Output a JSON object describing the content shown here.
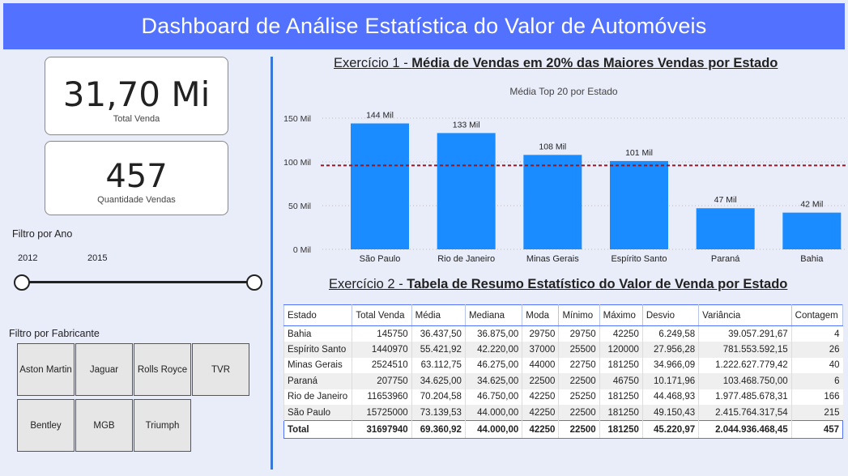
{
  "header": {
    "title": "Dashboard de Análise Estatística do Valor de Automóveis"
  },
  "kpis": {
    "total_venda": {
      "value": "31,70 Mi",
      "label": "Total Venda"
    },
    "quantidade": {
      "value": "457",
      "label": "Quantidade Vendas"
    }
  },
  "filtro_ano": {
    "label": "Filtro por Ano",
    "start": "2012",
    "end": "2015"
  },
  "filtro_fabricante": {
    "label": "Filtro por Fabricante",
    "items": [
      "Aston Martin",
      "Jaguar",
      "Rolls Royce",
      "TVR",
      "Bentley",
      "MGB",
      "Triumph"
    ]
  },
  "exercicio1": {
    "prefix": "Exercício 1 - ",
    "title": "Média de Vendas em 20% das Maiores Vendas por Estado"
  },
  "exercicio2": {
    "prefix": "Exercício 2 - ",
    "title": "Tabela de Resumo Estatístico do Valor de Venda por Estado"
  },
  "chart_data": {
    "type": "bar",
    "title": "Média Top 20 por Estado",
    "categories": [
      "São Paulo",
      "Rio de Janeiro",
      "Minas Gerais",
      "Espírito Santo",
      "Paraná",
      "Bahia"
    ],
    "values": [
      144000,
      133000,
      108000,
      101000,
      47000,
      42000
    ],
    "data_labels": [
      "144 Mil",
      "133 Mil",
      "108 Mil",
      "101 Mil",
      "47 Mil",
      "42 Mil"
    ],
    "ylim": [
      0,
      150000
    ],
    "yticks": [
      0,
      50000,
      100000,
      150000
    ],
    "ytick_labels": [
      "0 Mil",
      "50 Mil",
      "100 Mil",
      "150 Mil"
    ],
    "reference_line": 96000,
    "bar_color": "#1a8cff",
    "reference_color": "#8b1a2b",
    "grid": true
  },
  "table": {
    "columns": [
      "Estado",
      "Total Venda",
      "Média",
      "Mediana",
      "Moda",
      "Mínimo",
      "Máximo",
      "Desvio",
      "Variância",
      "Contagem"
    ],
    "rows": [
      [
        "Bahia",
        "145750",
        "36.437,50",
        "36.875,00",
        "29750",
        "29750",
        "42250",
        "6.249,58",
        "39.057.291,67",
        "4"
      ],
      [
        "Espírito Santo",
        "1440970",
        "55.421,92",
        "42.220,00",
        "37000",
        "25500",
        "120000",
        "27.956,28",
        "781.553.592,15",
        "26"
      ],
      [
        "Minas Gerais",
        "2524510",
        "63.112,75",
        "46.275,00",
        "44000",
        "22750",
        "181250",
        "34.966,09",
        "1.222.627.779,42",
        "40"
      ],
      [
        "Paraná",
        "207750",
        "34.625,00",
        "34.625,00",
        "22500",
        "22500",
        "46750",
        "10.171,96",
        "103.468.750,00",
        "6"
      ],
      [
        "Rio de Janeiro",
        "11653960",
        "70.204,58",
        "46.750,00",
        "42250",
        "25250",
        "181250",
        "44.468,93",
        "1.977.485.678,31",
        "166"
      ],
      [
        "São Paulo",
        "15725000",
        "73.139,53",
        "44.000,00",
        "42250",
        "22500",
        "181250",
        "49.150,43",
        "2.415.764.317,54",
        "215"
      ]
    ],
    "total": [
      "Total",
      "31697940",
      "69.360,92",
      "44.000,00",
      "42250",
      "22500",
      "181250",
      "45.220,97",
      "2.044.936.468,45",
      "457"
    ]
  }
}
